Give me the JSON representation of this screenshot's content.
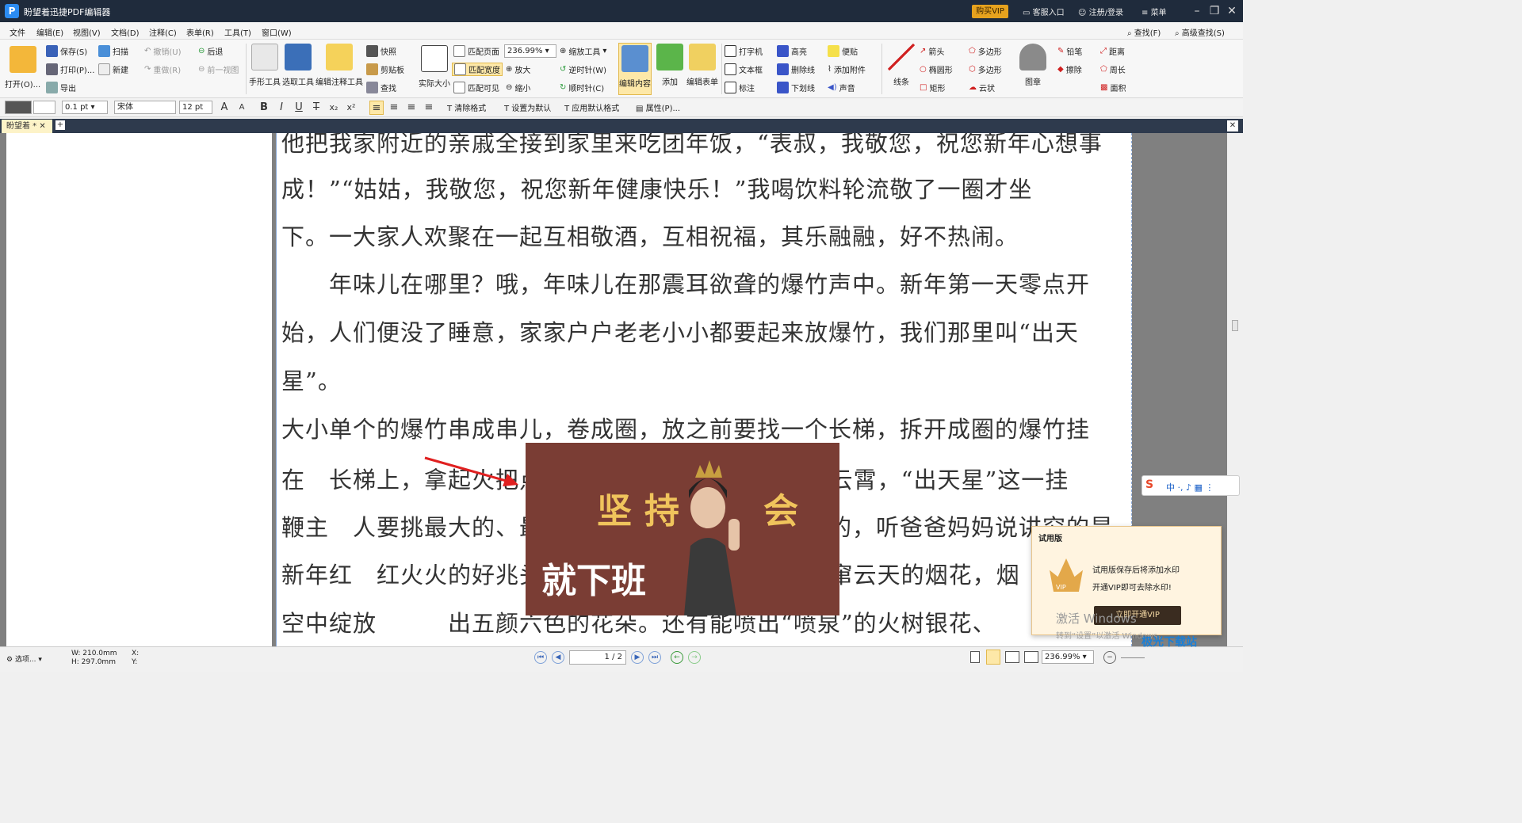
{
  "titlebar": {
    "logo_letter": "P",
    "title": "盼望着迅捷PDF编辑器",
    "vip_button": "购买VIP",
    "service": "客服入口",
    "login": "注册/登录",
    "menu": "菜单"
  },
  "menubar": {
    "items": [
      "文件",
      "编辑(E)",
      "视图(V)",
      "文档(D)",
      "注释(C)",
      "表单(R)",
      "工具(T)",
      "窗口(W)"
    ],
    "find": "查找(F)",
    "advanced_find": "高级查找(S)"
  },
  "ribbon": {
    "open": "打开(O)...",
    "save": "保存(S)",
    "print": "打印(P)...",
    "export": "导出",
    "scan": "扫描",
    "new": "新建",
    "undo": "撤销(U)",
    "redo": "重做(R)",
    "back": "后退",
    "prev_view": "前一视图",
    "hand_tool": "手形工具",
    "select_tool": "选取工具",
    "edit_annot_tool": "编辑注释工具",
    "snapshot": "快照",
    "clipboard": "剪贴板",
    "find": "查找",
    "actual_size": "实际大小",
    "fit_page": "匹配页面",
    "fit_width": "匹配宽度",
    "fit_visible": "匹配可见",
    "zoom_value": "236.99%",
    "zoom_tool": "缩放工具",
    "zoom_in": "放大",
    "zoom_out": "缩小",
    "rotate_ccw": "逆时针(W)",
    "rotate_cw": "顺时针(C)",
    "edit_content": "编辑内容",
    "add": "添加",
    "edit_form": "编辑表单",
    "typewriter": "打字机",
    "textbox": "文本框",
    "callout": "标注",
    "highlight": "高亮",
    "strikeout": "删除线",
    "underline": "下划线",
    "note": "便贴",
    "attach": "添加附件",
    "sound": "声音",
    "line": "线条",
    "arrow": "箭头",
    "ellipse": "椭圆形",
    "rect": "矩形",
    "polygon1": "多边形",
    "polygon2": "多边形",
    "cloud": "云状",
    "stamp": "图章",
    "pencil": "铅笔",
    "eraser": "擦除",
    "distance": "距离",
    "perimeter": "周长",
    "area": "面积"
  },
  "format": {
    "stroke": "0.1 pt",
    "font": "宋体",
    "size": "12 pt",
    "clear_format": "清除格式",
    "set_default": "设置为默认",
    "apply_default": "应用默认格式",
    "properties": "属性(P)..."
  },
  "tab": {
    "name": "盼望着 *"
  },
  "document": {
    "lines": [
      "他把我家附近的亲戚全接到家里来吃团年饭，“表叔，我敬您，祝您新年心想事",
      "成！”“姑姑，我敬您，祝您新年健康快乐！”我喝饮料轮流敬了一圈才坐",
      "下。一大家人欢聚在一起互相敬酒，互相祝福，其乐融融，好不热闹。",
      "　　年味儿在哪里？哦，年味儿在那震耳欲聋的爆竹声中。新年第一天零点开",
      "始，人们便没了睡意，家家户户老老小小都要起来放爆竹，我们那里叫“出天",
      "星”。",
      "大小单个的爆竹串成串儿，卷成圈，放之前要找一个长梯，拆开成圈的爆竹挂",
      "在　长梯上，拿起火把点燃导火线，“噼里啪啦”响彻云霄，“出天星”这一挂",
      "鞭主　人要挑最大的、最响的，点火的也要找最能干的，听爸爸妈妈说讲究的是",
      "新年红　红火火的好兆头，“出天星”后我们还放了直窜云天的烟花，烟",
      "空中绽放　　　出五颜六色的花朵。还有能喷出“喷泉”的火树银花、"
    ],
    "image_text_1": "坚持",
    "image_text_2": "会",
    "image_text_3": "就下班"
  },
  "trial_popup": {
    "title": "试用版",
    "line1": "试用版保存后将添加水印",
    "line2": "开通VIP即可去除水印!",
    "button": "立即开通VIP",
    "badge": "VIP"
  },
  "os_watermark": {
    "line1": "激活 Windows",
    "line2": "转到“设置”以激活 Windows。"
  },
  "statusbar": {
    "options": "选项...",
    "width": "W: 210.0mm",
    "height": "H: 297.0mm",
    "x": "X:",
    "y": "Y:",
    "page": "1 / 2",
    "zoom": "236.99%"
  },
  "site_watermark": "极光下载站",
  "colors": {
    "titlebar": "#1f2b3c",
    "vip": "#e6a21e",
    "stamp_bg": "#7a3d34",
    "stamp_text": "#f0c45c",
    "arrow": "#e02020"
  }
}
